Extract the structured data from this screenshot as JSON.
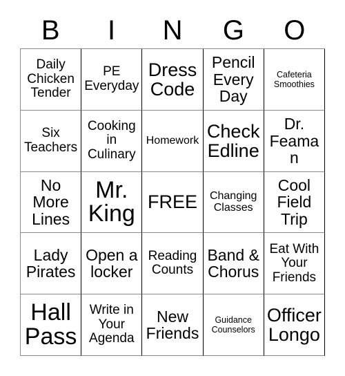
{
  "card": {
    "header_letters": [
      "B",
      "I",
      "N",
      "G",
      "O"
    ],
    "rows": [
      [
        {
          "text": "Daily Chicken Tender",
          "size": "md"
        },
        {
          "text": "PE Everyday",
          "size": "md"
        },
        {
          "text": "Dress Code",
          "size": "xl"
        },
        {
          "text": "Pencil Every Day",
          "size": "lg"
        },
        {
          "text": "Cafeteria Smoothies",
          "size": "xs"
        }
      ],
      [
        {
          "text": "Six Teachers",
          "size": "md"
        },
        {
          "text": "Cooking in Culinary",
          "size": "md"
        },
        {
          "text": "Homework",
          "size": "sm"
        },
        {
          "text": "Check Edline",
          "size": "xl"
        },
        {
          "text": "Dr. Feaman",
          "size": "lg"
        }
      ],
      [
        {
          "text": "No More Lines",
          "size": "lg"
        },
        {
          "text": "Mr. King",
          "size": "xxl"
        },
        {
          "text": "FREE",
          "size": "xl"
        },
        {
          "text": "Changing Classes",
          "size": "sm"
        },
        {
          "text": "Cool Field Trip",
          "size": "lg"
        }
      ],
      [
        {
          "text": "Lady Pirates",
          "size": "lg"
        },
        {
          "text": "Open a locker",
          "size": "lg"
        },
        {
          "text": "Reading Counts",
          "size": "md"
        },
        {
          "text": "Band & Chorus",
          "size": "lg"
        },
        {
          "text": "Eat With Your Friends",
          "size": "md"
        }
      ],
      [
        {
          "text": "Hall Pass",
          "size": "xxl"
        },
        {
          "text": "Write in Your Agenda",
          "size": "md"
        },
        {
          "text": "New Friends",
          "size": "lg"
        },
        {
          "text": "Guidance Counselors",
          "size": "xs"
        },
        {
          "text": "Officer Longo",
          "size": "xl"
        }
      ]
    ]
  },
  "colors": {
    "background": "#ffffff",
    "text": "#000000",
    "grid_line": "#8a8a8a",
    "grid_line_strong": "#000000"
  }
}
